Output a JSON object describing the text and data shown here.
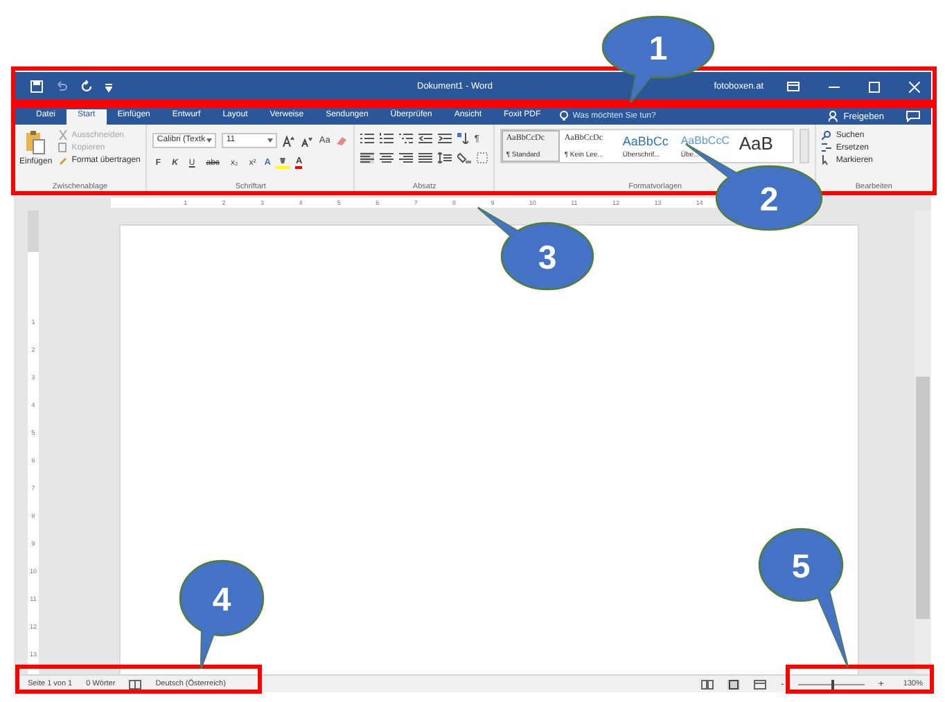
{
  "title_bar": {
    "title": "Dokument1 - Word",
    "user": "fotoboxen.at"
  },
  "tabs": [
    {
      "label": "Datei",
      "selected": false
    },
    {
      "label": "Start",
      "selected": true
    },
    {
      "label": "Einfügen",
      "selected": false
    },
    {
      "label": "Entwurf",
      "selected": false
    },
    {
      "label": "Layout",
      "selected": false
    },
    {
      "label": "Verweise",
      "selected": false
    },
    {
      "label": "Sendungen",
      "selected": false
    },
    {
      "label": "Überprüfen",
      "selected": false
    },
    {
      "label": "Ansicht",
      "selected": false
    },
    {
      "label": "Foxit PDF",
      "selected": false
    }
  ],
  "tell_me": {
    "placeholder": "Was möchten Sie tun?"
  },
  "share_button": "Freigeben",
  "clipboard": {
    "paste": "Einfügen",
    "items": [
      {
        "label": "Ausschneiden",
        "disabled": true
      },
      {
        "label": "Kopieren",
        "disabled": true
      },
      {
        "label": "Format übertragen",
        "disabled": false
      }
    ],
    "group_label": "Zwischenablage"
  },
  "font": {
    "family": "Calibri (Textk",
    "size": "11",
    "case_button": "Aa",
    "format_buttons": [
      "F",
      "K",
      "U",
      "abc",
      "x₂",
      "x²"
    ],
    "effects": "A",
    "color_button": "A",
    "group_label": "Schriftart"
  },
  "paragraph": {
    "pilcrow": "¶",
    "group_label": "Absatz"
  },
  "styles": {
    "items": [
      {
        "sample": "AaBbCcDc",
        "name": "¶ Standard",
        "selected": true
      },
      {
        "sample": "AaBbCcDc",
        "name": "¶ Kein Lee...",
        "selected": false
      },
      {
        "sample": "AaBbCc",
        "name": "Überschrif...",
        "selected": false
      },
      {
        "sample": "AaBbCcC",
        "name": "Übe...",
        "selected": false
      },
      {
        "sample": "AaB",
        "selected": false
      }
    ],
    "group_label": "Formatvorlagen"
  },
  "editing": {
    "items": [
      "Suchen",
      "Ersetzen",
      "Markieren"
    ],
    "group_label": "Bearbeiten"
  },
  "ruler": {
    "horizontal": [
      "1",
      "2",
      "3",
      "4",
      "5",
      "6",
      "7",
      "8",
      "9",
      "10",
      "11",
      "12",
      "13",
      "14"
    ],
    "vertical": [
      "1",
      "2",
      "3",
      "4",
      "5",
      "6",
      "7",
      "8",
      "9",
      "10",
      "11",
      "12",
      "13"
    ]
  },
  "status_bar": {
    "page": "Seite 1 von 1",
    "words": "0 Wörter",
    "language": "Deutsch (Österreich)",
    "zoom_minus": "-",
    "zoom_plus": "+",
    "zoom": {
      "level": 0.5
    },
    "zoom_reading": "130%"
  },
  "callouts": [
    {
      "number": "1"
    },
    {
      "number": "2"
    },
    {
      "number": "3"
    },
    {
      "number": "4"
    },
    {
      "number": "5"
    }
  ]
}
